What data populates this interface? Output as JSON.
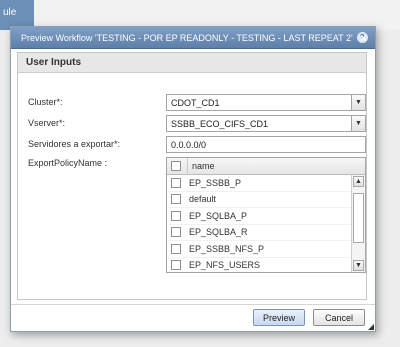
{
  "background": {
    "tab_label": "ule"
  },
  "dialog": {
    "title": "Preview Workflow 'TESTING - POR EP READONLY - TESTING - LAST REPEAT 2'",
    "help_icon": "?",
    "close_icon": "×",
    "panel_title": "User Inputs",
    "fields": {
      "cluster": {
        "label": "Cluster*:",
        "value": "CDOT_CD1"
      },
      "vserver": {
        "label": "Vserver*:",
        "value": "SSBB_ECO_CIFS_CD1"
      },
      "servidores": {
        "label": "Servidores a exportar*:",
        "value": "0.0.0.0/0"
      },
      "export_policy": {
        "label": "ExportPolicyName :"
      }
    },
    "grid": {
      "column": "name",
      "rows": [
        "EP_SSBB_P",
        "default",
        "EP_SQLBA_P",
        "EP_SQLBA_R",
        "EP_SSBB_NFS_P",
        "EP_NFS_USERS"
      ]
    },
    "buttons": {
      "preview": "Preview",
      "cancel": "Cancel"
    }
  }
}
